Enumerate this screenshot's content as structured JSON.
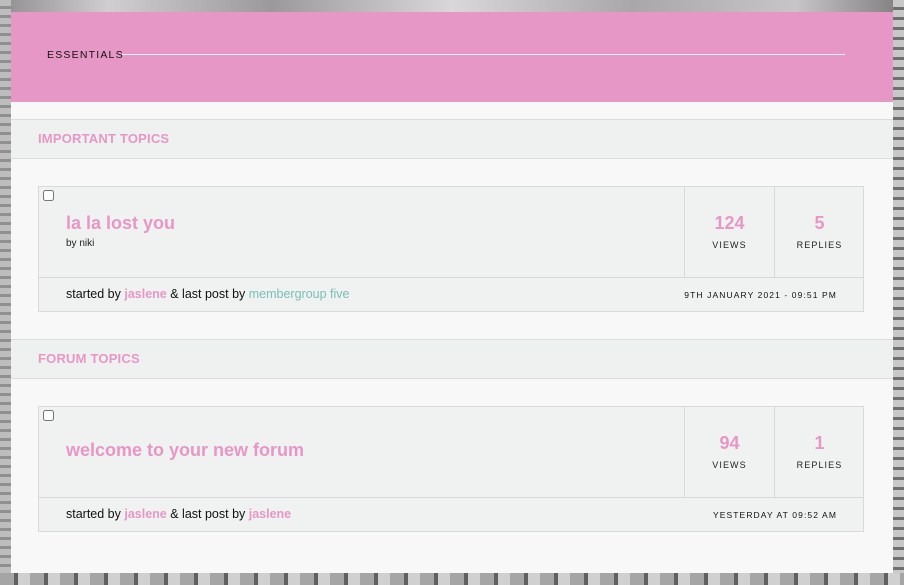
{
  "theme": {
    "pink": "#e797c6",
    "teal": "#78c0b8"
  },
  "category": {
    "title": "ESSENTIALS"
  },
  "sections": [
    {
      "title": "IMPORTANT TOPICS",
      "topic": {
        "title": "la la lost you",
        "description": "by niki",
        "views": "124",
        "views_label": "VIEWS",
        "replies": "5",
        "replies_label": "REPLIES",
        "started_prefix": "started by ",
        "starter": "jaslene",
        "last_prefix": " & last post by ",
        "last_poster": "membergroup five",
        "date": "9TH JANUARY 2021 - 09:51 PM"
      }
    },
    {
      "title": "FORUM TOPICS",
      "topic": {
        "title": "welcome to your new forum",
        "description": "",
        "views": "94",
        "views_label": "VIEWS",
        "replies": "1",
        "replies_label": "REPLIES",
        "started_prefix": "started by ",
        "starter": "jaslene",
        "last_prefix": " & last post by ",
        "last_poster": "jaslene",
        "date": "YESTERDAY AT 09:52 AM"
      }
    }
  ]
}
